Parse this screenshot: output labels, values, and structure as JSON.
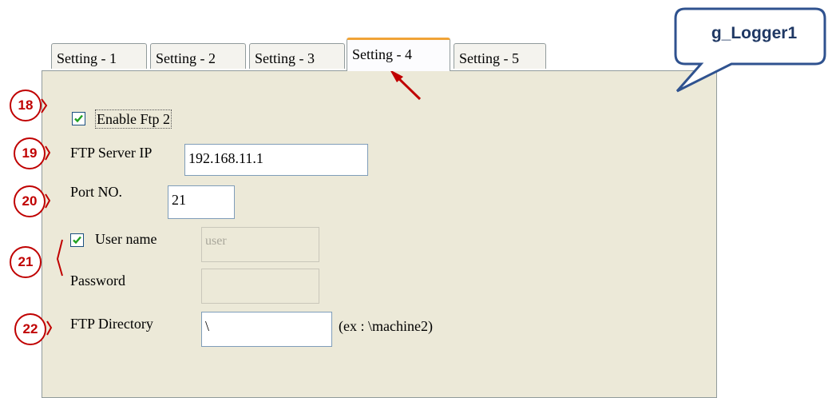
{
  "colors": {
    "accent": "#c00000",
    "callout_border": "#2f528f",
    "tab_highlight": "#f0a336"
  },
  "tabs": [
    {
      "label": "Setting - 1"
    },
    {
      "label": "Setting - 2"
    },
    {
      "label": "Setting - 3"
    },
    {
      "label": "Setting - 4",
      "active": true
    },
    {
      "label": "Setting - 5"
    }
  ],
  "callout": {
    "text": "g_Logger1"
  },
  "annotations": {
    "n18": "18",
    "n19": "19",
    "n20": "20",
    "n21": "21",
    "n22": "22"
  },
  "form": {
    "enable_ftp": {
      "label": "Enable Ftp 2",
      "checked": true
    },
    "server_ip": {
      "label": "FTP Server IP",
      "value": "192.168.11.1"
    },
    "port": {
      "label": "Port NO.",
      "value": "21"
    },
    "user_name": {
      "label": "User name",
      "checked": true,
      "value": "user"
    },
    "password": {
      "label": "Password",
      "value": ""
    },
    "directory": {
      "label": "FTP Directory",
      "value": "\\",
      "hint": "(ex : \\machine2)"
    }
  }
}
